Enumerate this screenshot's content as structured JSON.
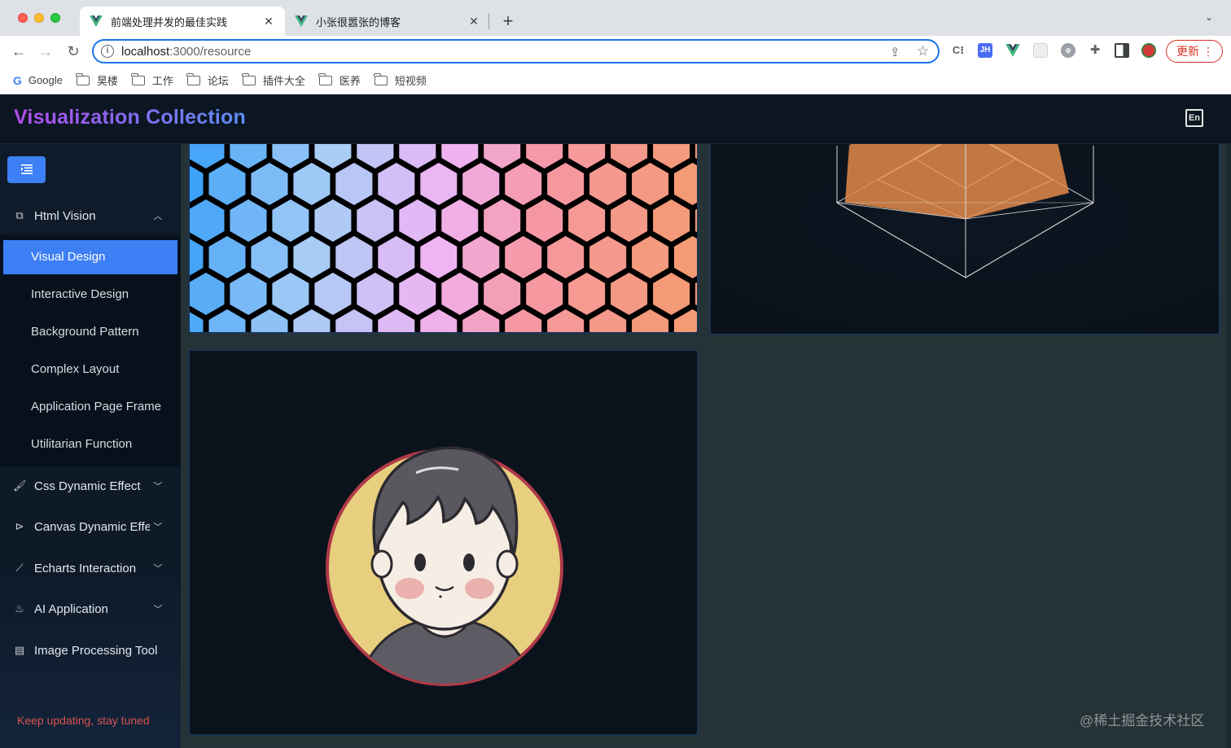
{
  "browser": {
    "tabs": [
      {
        "title": "前端处理并发的最佳实践",
        "active": true
      },
      {
        "title": "小张很嚣张的博客",
        "active": false
      }
    ],
    "address": {
      "host": "localhost",
      "path": ":3000/resource"
    },
    "update_label": "更新",
    "bookmarks": [
      "Google",
      "昊楼",
      "工作",
      "论坛",
      "插件大全",
      "医养",
      "短视频"
    ]
  },
  "app": {
    "title": "Visualization Collection",
    "lang_icon": "En",
    "sidebar": {
      "groups": [
        {
          "label": "Html Vision",
          "icon": "layout-icon",
          "expanded": true,
          "items": [
            "Visual Design",
            "Interactive Design",
            "Background Pattern",
            "Complex Layout",
            "Application Page Frame",
            "Utilitarian Function"
          ],
          "active_item": "Visual Design"
        },
        {
          "label": "Css Dynamic Effect",
          "icon": "brush-icon",
          "expanded": false
        },
        {
          "label": "Canvas Dynamic Effe",
          "icon": "play-circle-icon",
          "expanded": false
        },
        {
          "label": "Echarts Interaction",
          "icon": "line-chart-icon",
          "expanded": false
        },
        {
          "label": "AI Application",
          "icon": "flame-icon",
          "expanded": false
        },
        {
          "label": "Image Processing Tool",
          "icon": "document-icon",
          "expanded": false
        }
      ],
      "footer": "Keep updating, stay tuned"
    },
    "watermark": "@稀土掘金技术社区",
    "colors": {
      "accent": "#3d7ff4",
      "footer_text": "#d9534f",
      "radar_fill": "#e48a4a"
    }
  }
}
